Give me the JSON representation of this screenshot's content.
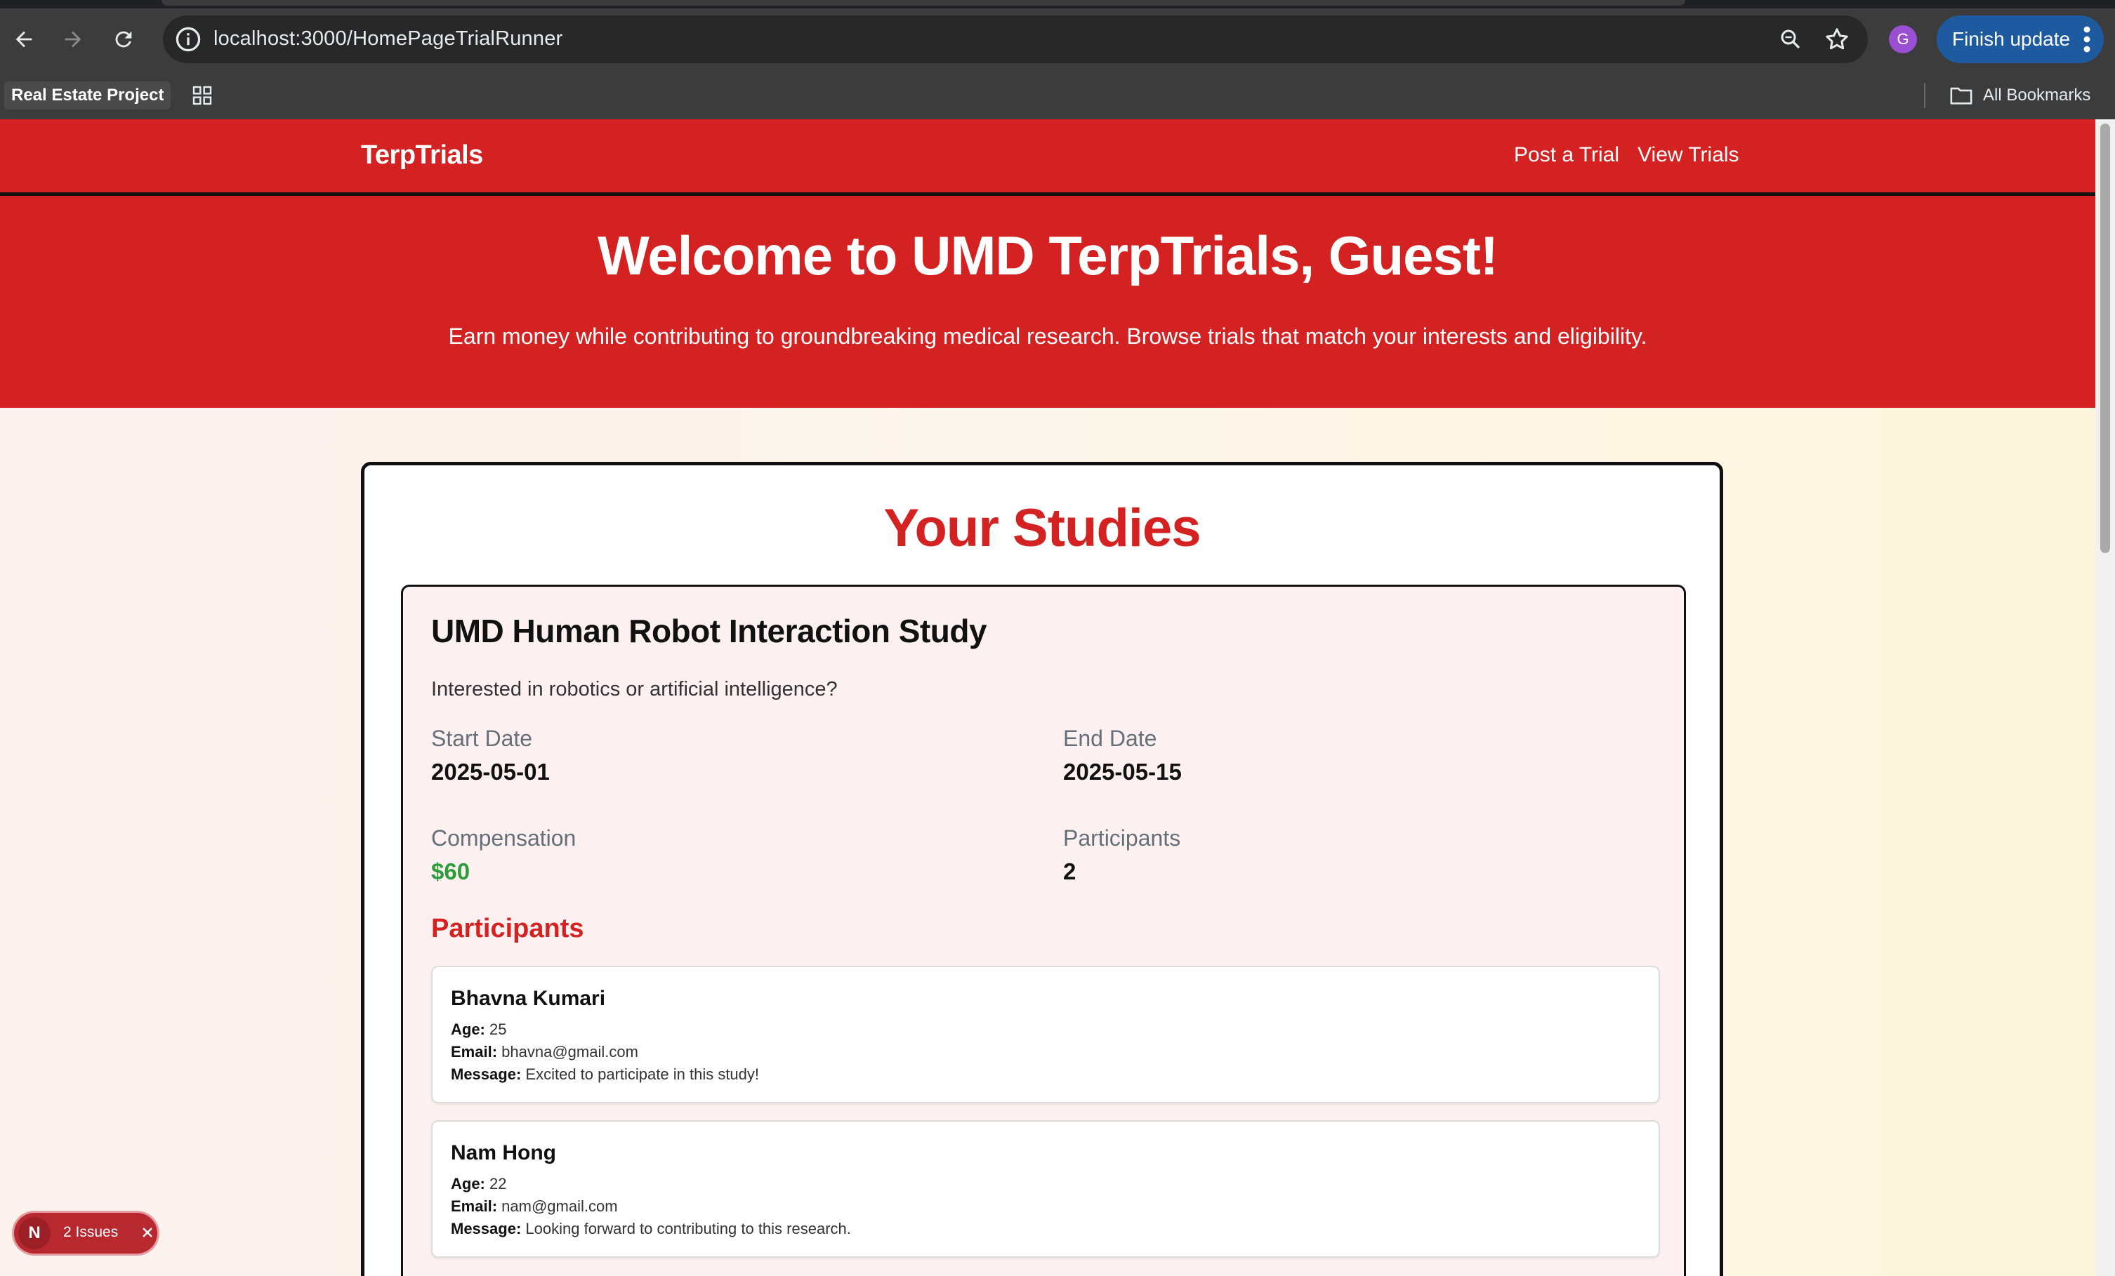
{
  "browser": {
    "url": "localhost:3000/HomePageTrialRunner",
    "profile_initial": "G",
    "finish_update_label": "Finish update",
    "bookmarks": {
      "project": "Real Estate Project",
      "all": "All Bookmarks"
    }
  },
  "colors": {
    "brand_red": "#d42222",
    "money_green": "#2a9d3a"
  },
  "nav": {
    "brand": "TerpTrials",
    "links": [
      "Post a Trial",
      "View Trials"
    ]
  },
  "hero": {
    "title": "Welcome to UMD TerpTrials, Guest!",
    "subtitle": "Earn money while contributing to groundbreaking medical research. Browse trials that match your interests and eligibility."
  },
  "studies": {
    "heading": "Your Studies",
    "items": [
      {
        "title": "UMD Human Robot Interaction Study",
        "description": "Interested in robotics or artificial intelligence?",
        "start_label": "Start Date",
        "start": "2025-05-01",
        "end_label": "End Date",
        "end": "2025-05-15",
        "comp_label": "Compensation",
        "comp": "$60",
        "count_label": "Participants",
        "count": "2",
        "participants_heading": "Participants",
        "participants": [
          {
            "name": "Bhavna Kumari",
            "age": "25",
            "email": "bhavna@gmail.com",
            "message": "Excited to participate in this study!"
          },
          {
            "name": "Nam Hong",
            "age": "22",
            "email": "nam@gmail.com",
            "message": "Looking forward to contributing to this research."
          }
        ]
      }
    ]
  },
  "labels": {
    "age": "Age:",
    "email": "Email:",
    "message": "Message:"
  },
  "devtools": {
    "badge_letter": "N",
    "issues": "2 Issues"
  }
}
